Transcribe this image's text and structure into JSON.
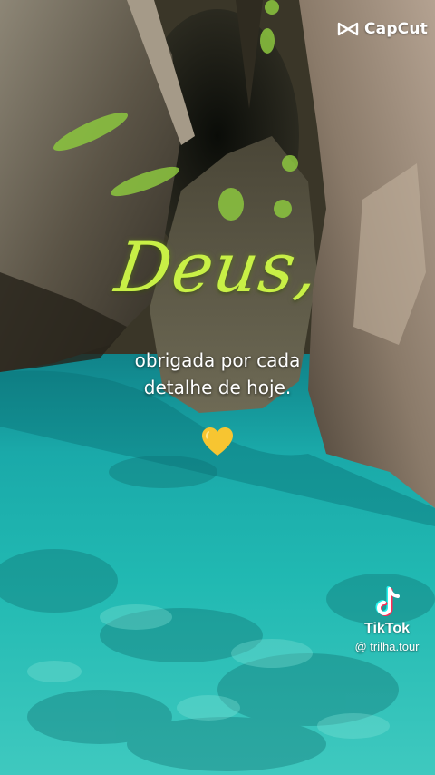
{
  "watermark_top": {
    "brand": "CapCut",
    "icon": "capcut-logo-icon"
  },
  "overlay": {
    "title": "Deus,",
    "subtitle_lines": [
      "obrigada por cada",
      "detalhe de hoje."
    ],
    "emoji": "yellow-heart-icon",
    "title_color": "#c8f046"
  },
  "watermark_bottom": {
    "brand": "TikTok",
    "handle": "@ trilha.tour",
    "icon": "tiktok-logo-icon"
  },
  "colors": {
    "water": "#1fb6b0",
    "rock": "#6d6355",
    "heart": "#f7c531"
  }
}
